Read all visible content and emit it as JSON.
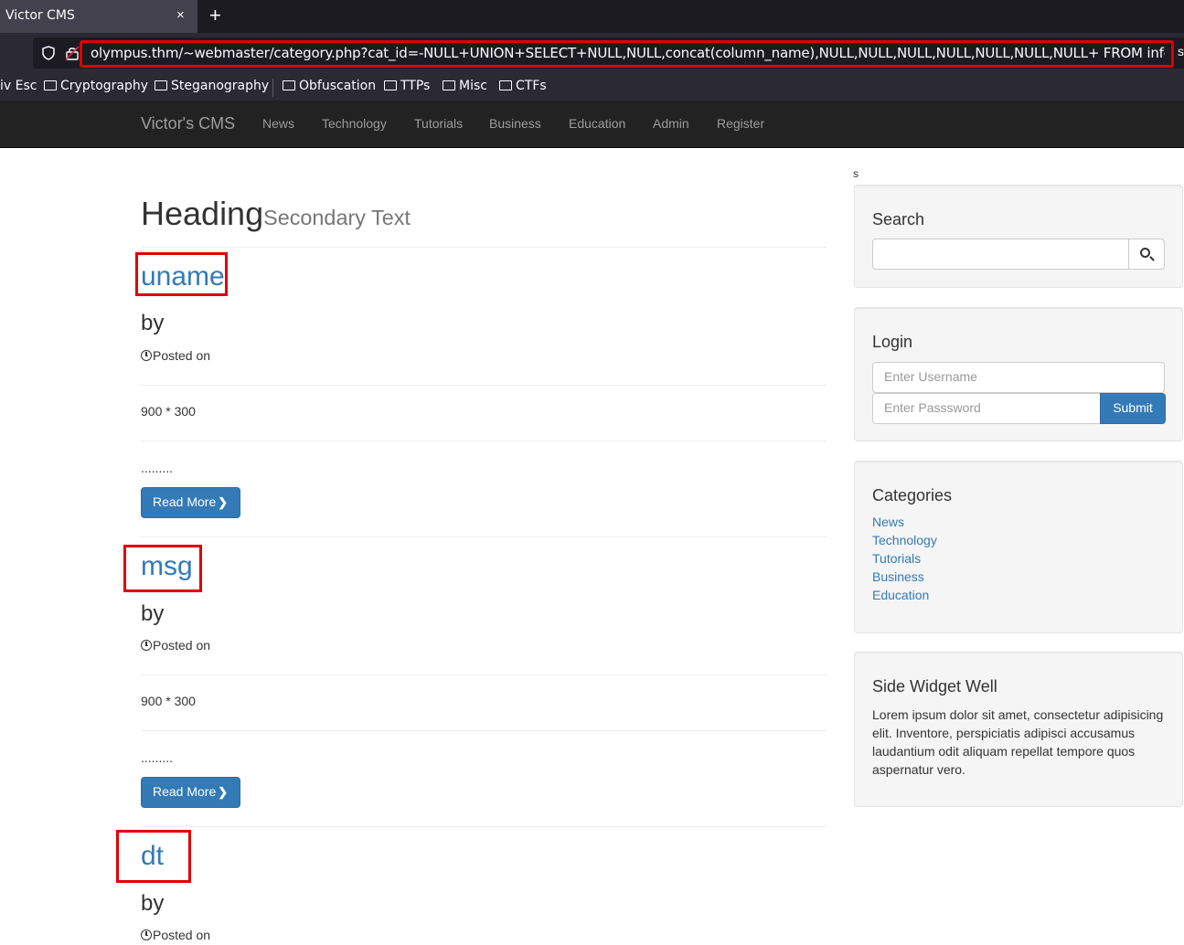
{
  "browser": {
    "tab_title": "Victor CMS",
    "tab_close": "×",
    "new_tab": "+",
    "url": "olympus.thm/~webmaster/category.php?cat_id=-NULL+UNION+SELECT+NULL,NULL,concat(column_name),NULL,NULL,NULL,NULL,NULL,NULL,NULL+ FROM information_s",
    "url_overflow": "s",
    "bookmarks": [
      "iv Esc",
      "Cryptography",
      "Steganography",
      "Obfuscation",
      "TTPs",
      "Misc",
      "CTFs"
    ]
  },
  "site": {
    "brand": "Victor's CMS",
    "nav": [
      "News",
      "Technology",
      "Tutorials",
      "Business",
      "Education",
      "Admin",
      "Register"
    ],
    "stray_text": "s",
    "heading": "Heading",
    "heading_small": "Secondary Text",
    "posts": [
      {
        "title": "uname",
        "by": "by",
        "posted": "Posted on",
        "image": "900 * 300",
        "excerpt": ".........",
        "read_more": "Read More"
      },
      {
        "title": "msg",
        "by": "by",
        "posted": "Posted on",
        "image": "900 * 300",
        "excerpt": ".........",
        "read_more": "Read More"
      },
      {
        "title": "dt",
        "by": "by",
        "posted": "Posted on"
      }
    ]
  },
  "sidebar": {
    "search": {
      "title": "Search",
      "value": ""
    },
    "login": {
      "title": "Login",
      "username_placeholder": "Enter Username",
      "password_placeholder": "Enter Passsword",
      "submit": "Submit"
    },
    "categories": {
      "title": "Categories",
      "items": [
        "News",
        "Technology",
        "Tutorials",
        "Business",
        "Education"
      ]
    },
    "widget": {
      "title": "Side Widget Well",
      "text": "Lorem ipsum dolor sit amet, consectetur adipisicing elit. Inventore, perspiciatis adipisci accusamus laudantium odit aliquam repellat tempore quos aspernatur vero."
    }
  },
  "colors": {
    "highlight_red": "#e00000",
    "link_blue": "#337ab7",
    "navbar": "#222222"
  }
}
